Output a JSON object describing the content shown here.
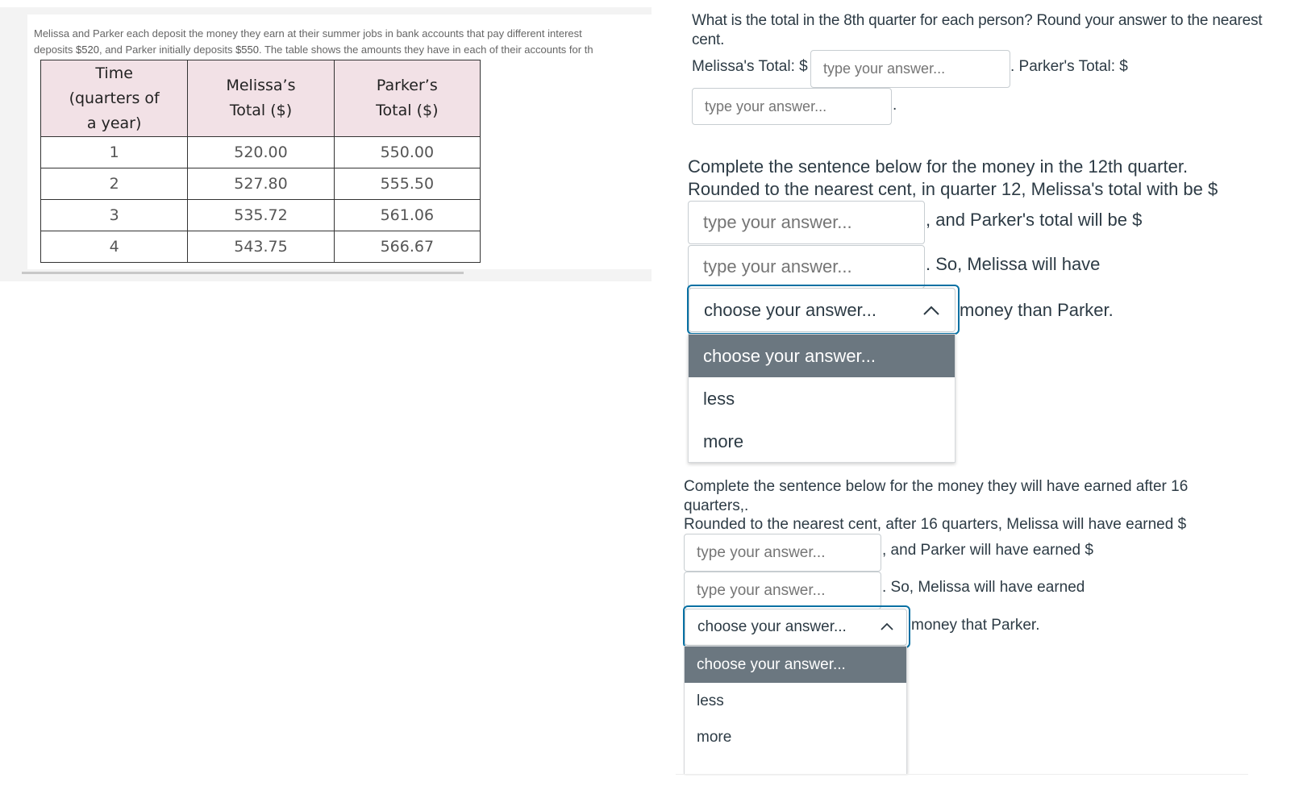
{
  "passage": {
    "line1": "Melissa and Parker each deposit the money they earn at their summer jobs in bank accounts that pay different interest",
    "line2_prefix": "deposits ",
    "melissa_deposit": "$520",
    "line2_mid": ", and Parker initially deposits ",
    "parker_deposit": "$550",
    "line2_suffix": ". The table shows the amounts they have in each of their accounts for th"
  },
  "table": {
    "headers": [
      "Time (quarters of a year)",
      "Melissa’s Total ($)",
      "Parker’s Total ($)"
    ],
    "header_lines": [
      [
        "Time",
        "(quarters of",
        "a year)"
      ],
      [
        "Melissa’s",
        "Total ($)"
      ],
      [
        "Parker’s",
        "Total ($)"
      ]
    ],
    "rows": [
      [
        "1",
        "520.00",
        "550.00"
      ],
      [
        "2",
        "527.80",
        "555.50"
      ],
      [
        "3",
        "535.72",
        "561.06"
      ],
      [
        "4",
        "543.75",
        "566.67"
      ]
    ]
  },
  "question1": {
    "prompt": "What is the total in the 8th quarter for each person? Round your answer to the nearest cent.",
    "melissa_label": "Melissa's Total: $",
    "parker_label": ". Parker's Total: $",
    "end": ".",
    "melissa_input": {
      "value": "",
      "placeholder": "type your answer..."
    },
    "parker_input": {
      "value": "",
      "placeholder": "type your answer..."
    }
  },
  "question2": {
    "line1": "Complete the sentence below for the money in the 12th quarter.",
    "line2": "Rounded to the nearest cent, in quarter 12, Melissa's total with be $",
    "after_input1": ", and Parker's total will be $",
    "after_input2": ". So, Melissa will have",
    "after_select": "money than Parker.",
    "input1": {
      "value": "",
      "placeholder": "type your answer..."
    },
    "input2": {
      "value": "",
      "placeholder": "type your answer..."
    },
    "select": {
      "selected": "choose your answer...",
      "expanded": true,
      "options": [
        "choose your answer...",
        "less",
        "more"
      ],
      "highlighted_index": 0
    }
  },
  "question3": {
    "line1": "Complete the sentence below for the money they will have earned after 16",
    "line1b": "quarters,.",
    "line2": "Rounded to the nearest cent, after 16 quarters, Melissa will have earned $",
    "after_input1": ", and Parker will have earned $",
    "after_input2": ". So, Melissa will have earned",
    "after_select": "money that Parker.",
    "input1": {
      "value": "",
      "placeholder": "type your answer..."
    },
    "input2": {
      "value": "",
      "placeholder": "type your answer..."
    },
    "select": {
      "selected": "choose your answer...",
      "expanded": true,
      "options": [
        "choose your answer...",
        "less",
        "more"
      ],
      "highlighted_index": 0
    }
  },
  "icons": {
    "select_chevron": "chevron-up-icon"
  },
  "colors": {
    "table_header_bg": "#f2e1e6",
    "focus_ring": "#0770a3",
    "dropdown_highlight": "#6b7780",
    "text": "#2d3b45",
    "placeholder": "#73818c"
  }
}
